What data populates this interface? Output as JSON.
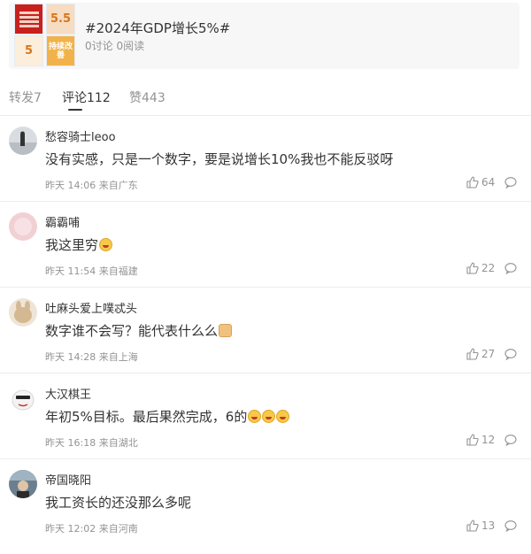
{
  "topic": {
    "title": "#2024年GDP增长5%#",
    "stats": "0讨论 0阅读",
    "thumbs": [
      "5.5",
      "5",
      "持续改善"
    ]
  },
  "tabs": [
    {
      "label": "转发7",
      "active": false
    },
    {
      "label": "评论112",
      "active": true
    },
    {
      "label": "赞443",
      "active": false
    }
  ],
  "comments": [
    {
      "username": "愁容骑士leoo",
      "content": "没有实感，只是一个数字，要是说增长10%我也不能反驳呀",
      "time": "昨天 14:06 来自广东",
      "likes": "64"
    },
    {
      "username": "霸霸哺",
      "content": "我这里穷",
      "time": "昨天 11:54 来自福建",
      "likes": "22"
    },
    {
      "username": "吐麻头爱上噗忒头",
      "content": "数字谁不会写？能代表什么么",
      "time": "昨天 14:28 来自上海",
      "likes": "27"
    },
    {
      "username": "大汉棋王",
      "content": "年初5%目标。最后果然完成，6的",
      "time": "昨天 16:18 来自湖北",
      "likes": "12"
    },
    {
      "username": "帝国晓阳",
      "content": "我工资长的还没那么多呢",
      "time": "昨天 12:02 来自河南",
      "likes": "13"
    }
  ],
  "colors": {
    "accent": "#333333",
    "muted": "#939393",
    "divider": "#ececec"
  }
}
